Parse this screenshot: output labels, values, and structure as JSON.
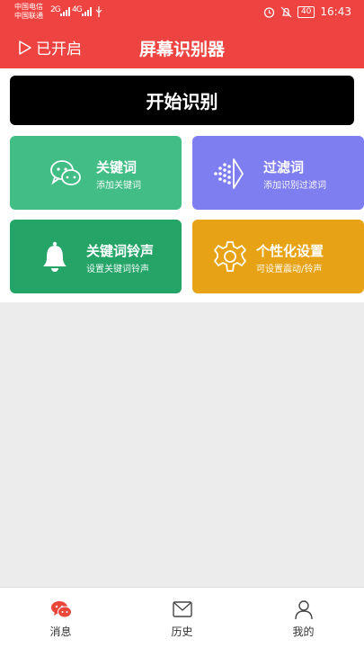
{
  "status_bar": {
    "carrier1": "中国电信",
    "carrier2": "中国联通",
    "net1": "2G",
    "net2": "4G",
    "battery": "40",
    "time": "16:43"
  },
  "header": {
    "toggle_label": "已开启",
    "title": "屏幕识别器"
  },
  "start_button": {
    "label": "开始识别"
  },
  "cards": [
    {
      "title": "关键词",
      "subtitle": "添加关键词",
      "icon": "chat-bubbles-icon",
      "color": "#41bd85"
    },
    {
      "title": "过滤词",
      "subtitle": "添加识别过滤词",
      "icon": "filter-dots-icon",
      "color": "#7f7ef0"
    },
    {
      "title": "关键词铃声",
      "subtitle": "设置关键词铃声",
      "icon": "bell-icon",
      "color": "#25a468"
    },
    {
      "title": "个性化设置",
      "subtitle": "可设置震动/铃声",
      "icon": "gear-icon",
      "color": "#e7a315"
    }
  ],
  "tabs": [
    {
      "label": "消息",
      "icon": "wechat-icon"
    },
    {
      "label": "历史",
      "icon": "envelope-icon"
    },
    {
      "label": "我的",
      "icon": "person-icon"
    }
  ],
  "colors": {
    "header": "#ee4441",
    "accent_red": "#e8473a"
  }
}
